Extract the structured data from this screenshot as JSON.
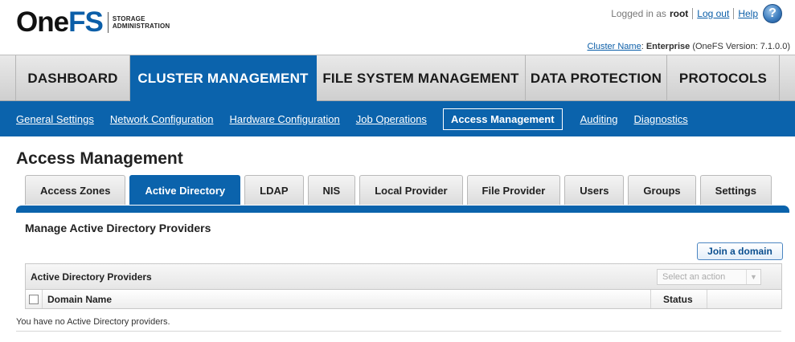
{
  "header": {
    "logo": {
      "word_one": "One",
      "word_fs": "FS",
      "sub_line1": "STORAGE",
      "sub_line2": "ADMINISTRATION"
    },
    "user": {
      "logged_in_prefix": "Logged in as",
      "username": "root",
      "logout_label": "Log out",
      "help_label": "Help",
      "help_icon": "?"
    },
    "cluster": {
      "name_label": "Cluster Name",
      "name_value": "Enterprise",
      "version_text": "(OneFS Version: 7.1.0.0)"
    }
  },
  "main_nav": {
    "tabs": [
      {
        "label": "DASHBOARD",
        "active": false
      },
      {
        "label": "CLUSTER MANAGEMENT",
        "active": true
      },
      {
        "label": "FILE SYSTEM MANAGEMENT",
        "active": false
      },
      {
        "label": "DATA PROTECTION",
        "active": false
      },
      {
        "label": "PROTOCOLS",
        "active": false
      }
    ]
  },
  "sub_nav": {
    "links": [
      {
        "label": "General Settings",
        "active": false
      },
      {
        "label": "Network Configuration",
        "active": false
      },
      {
        "label": "Hardware Configuration",
        "active": false
      },
      {
        "label": "Job Operations",
        "active": false
      },
      {
        "label": "Access Management",
        "active": true
      },
      {
        "label": "Auditing",
        "active": false
      },
      {
        "label": "Diagnostics",
        "active": false
      }
    ]
  },
  "page": {
    "title": "Access Management",
    "tabs": [
      {
        "label": "Access Zones",
        "active": false
      },
      {
        "label": "Active Directory",
        "active": true
      },
      {
        "label": "LDAP",
        "active": false
      },
      {
        "label": "NIS",
        "active": false
      },
      {
        "label": "Local Provider",
        "active": false
      },
      {
        "label": "File Provider",
        "active": false
      },
      {
        "label": "Users",
        "active": false
      },
      {
        "label": "Groups",
        "active": false
      },
      {
        "label": "Settings",
        "active": false
      }
    ],
    "section_title": "Manage Active Directory Providers",
    "join_button": "Join a domain",
    "panel": {
      "title": "Active Directory Providers",
      "action_placeholder": "Select an action",
      "columns": {
        "domain": "Domain Name",
        "status": "Status"
      }
    },
    "empty_message": "You have no Active Directory providers."
  },
  "colors": {
    "brand_blue": "#0b63ac",
    "link_blue": "#0b5ea8"
  }
}
